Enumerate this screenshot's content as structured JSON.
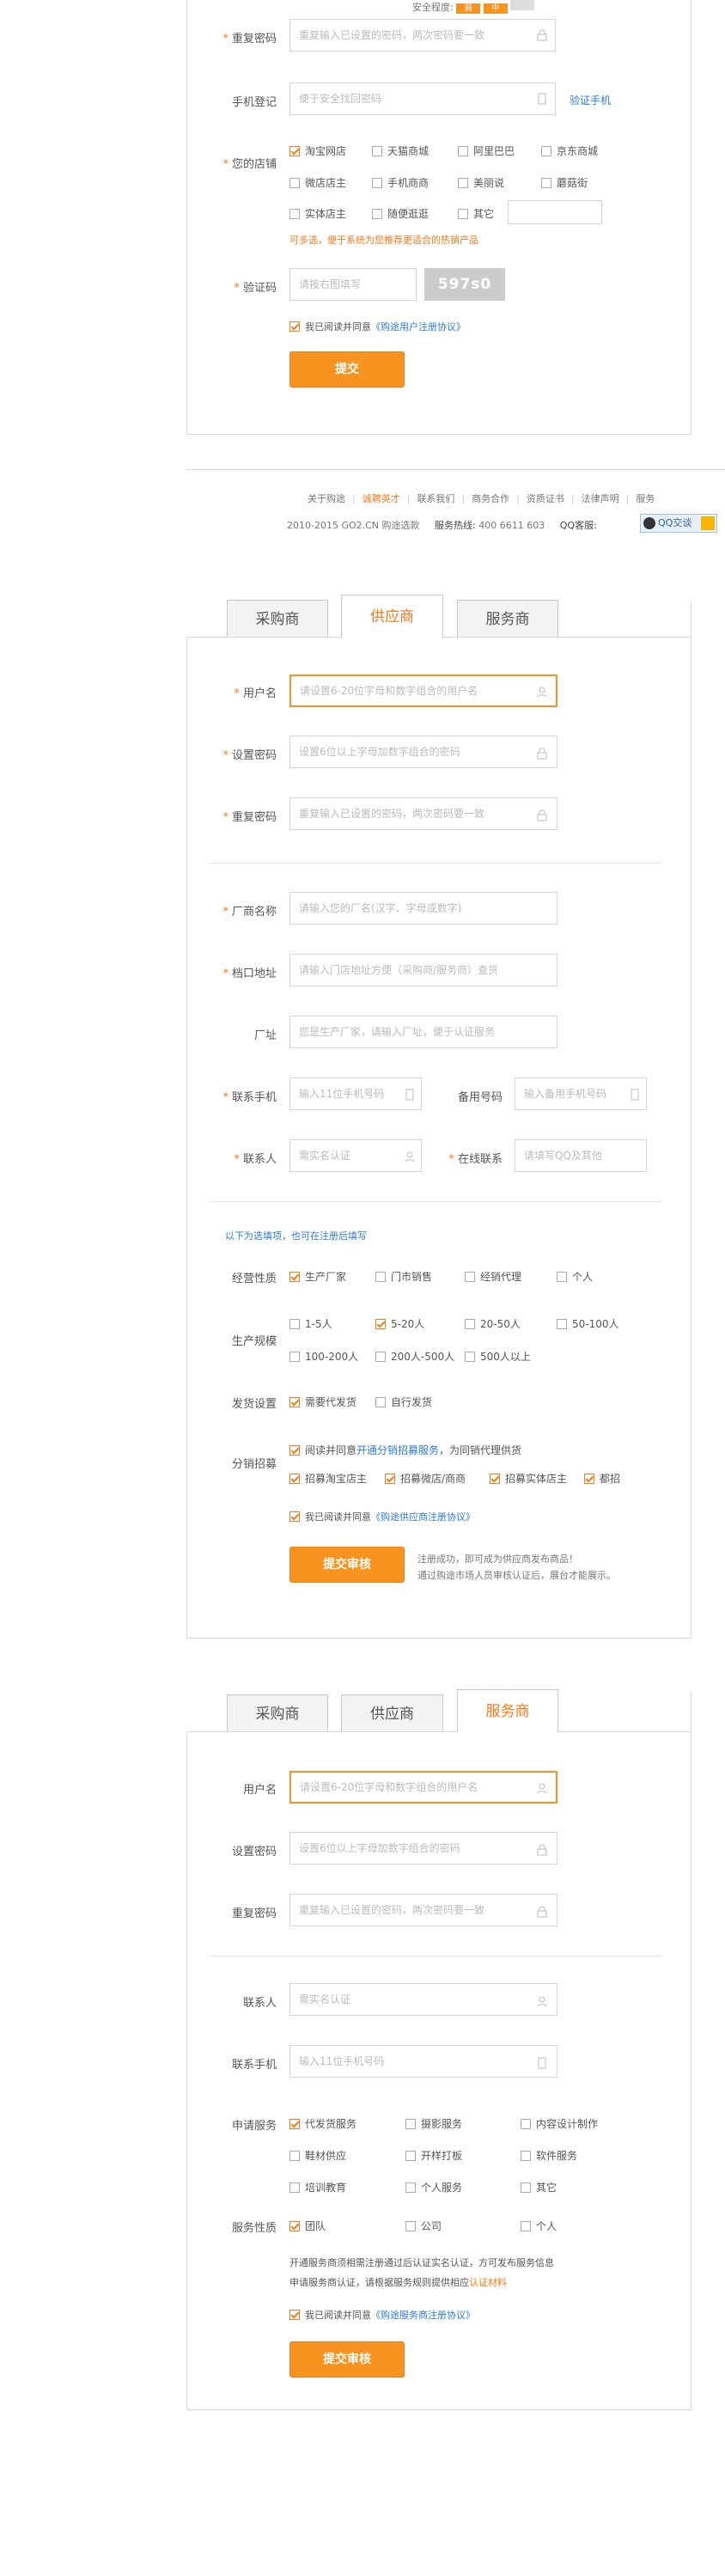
{
  "strength": {
    "label": "安全程度:",
    "levels": [
      "弱",
      "中",
      ""
    ]
  },
  "form1": {
    "confirm_label": "重复密码",
    "confirm_ph": "重复输入已设置的密码，两次密码要一致",
    "phone_label": "手机登记",
    "phone_ph": "便于安全找回密码",
    "phone_link": "验证手机",
    "shop_label": "您的店铺",
    "shops": [
      "淘宝网店",
      "天猫商城",
      "阿里巴巴",
      "京东商城",
      "微店店主",
      "手机商商",
      "美丽说",
      "蘑菇街",
      "实体店主",
      "随便逛逛",
      "其它"
    ],
    "shop_tip": "可多选，便于系统为您推荐更适合的热销产品",
    "code_label": "验证码",
    "code_ph": "请按右图填写",
    "code_img": "597s0",
    "agree_text": "我已阅读并同意",
    "agree_link": "《购途用户注册协议》",
    "submit": "提交"
  },
  "footer": {
    "links": [
      "关于购途",
      "诚聘英才",
      "联系我们",
      "商务合作",
      "资质证书",
      "法律声明",
      "服务"
    ],
    "copyright": "2010-2015 GO2.CN 购途选款",
    "hotline_label": "服务热线:",
    "hotline": "400 6611 603",
    "qq_label": "QQ客服:",
    "qq_btn": "QQ交谈"
  },
  "tabs": [
    "采购商",
    "供应商",
    "服务商"
  ],
  "form2": {
    "username_label": "用户名",
    "username_ph": "请设置6-20位字母和数字组合的用户名",
    "pwd_label": "设置密码",
    "pwd_ph": "设置6位以上字母加数字组合的密码",
    "confirm_label": "重复密码",
    "confirm_ph": "重复输入已设置的密码，两次密码要一致",
    "vendor_label": "厂商名称",
    "vendor_ph": "请输入您的厂名(汉字、字母或数字)",
    "stall_label": "档口地址",
    "stall_ph": "请输入门店地址方便（采购商/服务商）查货",
    "factory_label": "厂址",
    "factory_ph": "您是生产厂家，请输入厂址，便于认证服务",
    "mobile_label": "联系手机",
    "mobile_ph": "输入11位手机号码",
    "backup_label": "备用号码",
    "backup_ph": "输入备用手机号码",
    "contact_label": "联系人",
    "contact_ph": "需实名认证",
    "online_label": "在线联系",
    "online_ph": "请填写QQ及其他",
    "optional_note": "以下为选填项，也可在注册后填写",
    "nature_label": "经营性质",
    "nature": [
      "生产厂家",
      "门市销售",
      "经销代理",
      "个人"
    ],
    "scale_label": "生产规模",
    "scale": [
      "1-5人",
      "5-20人",
      "20-50人",
      "50-100人",
      "100-200人",
      "200人-500人",
      "500人以上"
    ],
    "ship_label": "发货设置",
    "ship": [
      "需要代发货",
      "自行发货"
    ],
    "dist_label": "分销招募",
    "dist_line1_a": "阅读并同意",
    "dist_line1_link": "开通分销招募服务",
    "dist_line1_b": "，为同销代理供货",
    "dist": [
      "招募淘宝店主",
      "招募微店/商商",
      "招募实体店主",
      "都招"
    ],
    "agree_text": "我已阅读并同意",
    "agree_link": "《购途供应商注册协议》",
    "submit": "提交审核",
    "note1": "注册成功，即可成为供应商发布商品！",
    "note2": "通过购途市场人员审核认证后，展台才能展示。"
  },
  "form3": {
    "username_label": "用户名",
    "username_ph": "请设置6-20位字母和数字组合的用户名",
    "pwd_label": "设置密码",
    "pwd_ph": "设置6位以上字母加数字组合的密码",
    "confirm_label": "重复密码",
    "confirm_ph": "重复输入已设置的密码，两次密码要一致",
    "contact_label": "联系人",
    "contact_ph": "需实名认证",
    "mobile_label": "联系手机",
    "mobile_ph": "输入11位手机号码",
    "service_label": "申请服务",
    "services": [
      "代发货服务",
      "摄影服务",
      "内容设计制作",
      "鞋材供应",
      "开样打板",
      "软件服务",
      "培训教育",
      "个人服务",
      "其它"
    ],
    "type_label": "服务性质",
    "types": [
      "团队",
      "公司",
      "个人"
    ],
    "info1": "开通服务商须相需注册通过后认证实名认证，方可发布服务信息",
    "info2": "申请服务商认证，请根据服务规则提供相应",
    "info2_link": "认证材料",
    "agree_text": "我已阅读并同意",
    "agree_link": "《购途服务商注册协议》",
    "submit": "提交审核"
  }
}
